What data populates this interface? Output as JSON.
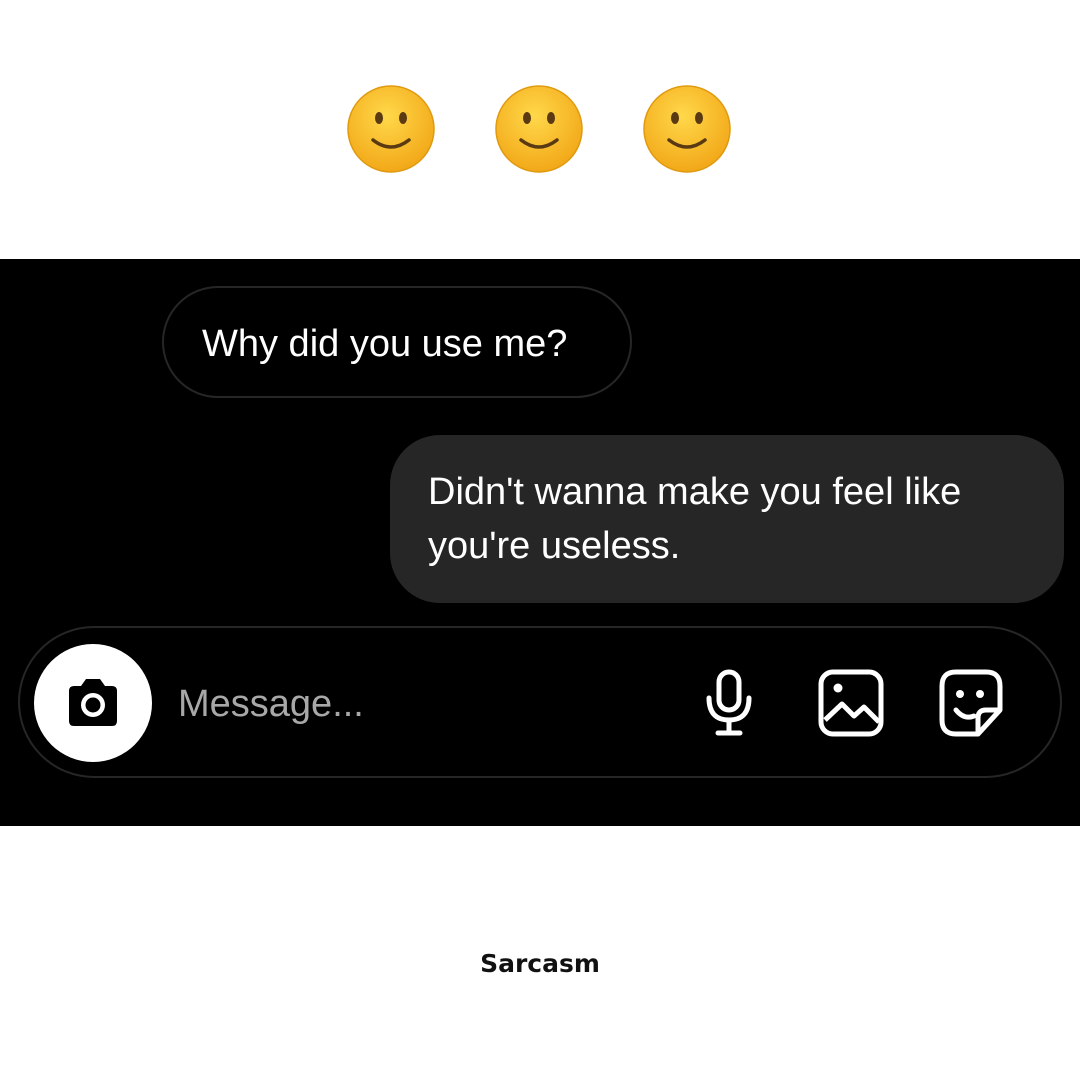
{
  "emoji_row": {
    "items": [
      {
        "icon": "slightly-smiling-face"
      },
      {
        "icon": "slightly-smiling-face"
      },
      {
        "icon": "slightly-smiling-face"
      }
    ]
  },
  "chat": {
    "messages": [
      {
        "direction": "received",
        "text": "Why did you use me?"
      },
      {
        "direction": "sent",
        "text": "Didn't wanna make you feel like you're useless."
      }
    ]
  },
  "composer": {
    "camera_icon": "camera-icon",
    "placeholder": "Message...",
    "value": "",
    "actions": [
      {
        "icon": "microphone-icon"
      },
      {
        "icon": "gallery-icon"
      },
      {
        "icon": "sticker-icon"
      }
    ]
  },
  "caption": "Sarcasm",
  "colors": {
    "panel_background": "#000000",
    "sent_bubble": "#262626",
    "bubble_border": "#262626",
    "emoji_face": "#f7b91d",
    "page_background": "#ffffff"
  }
}
